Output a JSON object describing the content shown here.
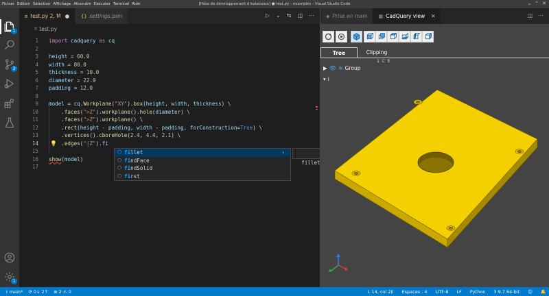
{
  "window": {
    "title": "[Hôte de développement d'extension] ● test.py - examples - Visual Studio Code",
    "menu": [
      "Fichier",
      "Edition",
      "Sélection",
      "Affichage",
      "Atteindre",
      "Exécuter",
      "Terminal",
      "Aide"
    ]
  },
  "activity": {
    "badges": {
      "explorer": "1",
      "scm": "3",
      "settings": "1"
    }
  },
  "tabs": [
    {
      "label": "test.py 2, M",
      "icon": "python-file-icon",
      "modified": true
    },
    {
      "label": "settings.json",
      "icon": "json-file-icon",
      "modified": false
    }
  ],
  "breadcrumb": {
    "file": "test.py"
  },
  "editor": {
    "lines": [
      {
        "n": "1",
        "tokens": [
          {
            "t": "import ",
            "c": "k"
          },
          {
            "t": "cadquery",
            "c": "n"
          },
          {
            "t": " as ",
            "c": "k"
          },
          {
            "t": "cq",
            "c": "n"
          }
        ]
      },
      {
        "n": "2",
        "tokens": []
      },
      {
        "n": "3",
        "tokens": [
          {
            "t": "height",
            "c": "n"
          },
          {
            "t": " = ",
            "c": ""
          },
          {
            "t": "60.0",
            "c": "num"
          }
        ]
      },
      {
        "n": "4",
        "tokens": [
          {
            "t": "width",
            "c": "n"
          },
          {
            "t": " = ",
            "c": ""
          },
          {
            "t": "80.0",
            "c": "num"
          }
        ]
      },
      {
        "n": "5",
        "tokens": [
          {
            "t": "thickness",
            "c": "n"
          },
          {
            "t": " = ",
            "c": ""
          },
          {
            "t": "10.0",
            "c": "num"
          }
        ]
      },
      {
        "n": "6",
        "tokens": [
          {
            "t": "diameter",
            "c": "n"
          },
          {
            "t": " = ",
            "c": ""
          },
          {
            "t": "22.0",
            "c": "num"
          }
        ]
      },
      {
        "n": "7",
        "tokens": [
          {
            "t": "padding",
            "c": "n"
          },
          {
            "t": " = ",
            "c": ""
          },
          {
            "t": "12.0",
            "c": "num"
          }
        ]
      },
      {
        "n": "8",
        "tokens": []
      },
      {
        "n": "9",
        "tokens": [
          {
            "t": "model",
            "c": "n"
          },
          {
            "t": " = ",
            "c": ""
          },
          {
            "t": "cq",
            "c": "n"
          },
          {
            "t": ".",
            "c": ""
          },
          {
            "t": "Workplane",
            "c": "f"
          },
          {
            "t": "(",
            "c": ""
          },
          {
            "t": "\"XY\"",
            "c": "s"
          },
          {
            "t": ").",
            "c": ""
          },
          {
            "t": "box",
            "c": "f"
          },
          {
            "t": "(",
            "c": ""
          },
          {
            "t": "height",
            "c": "n"
          },
          {
            "t": ", ",
            "c": ""
          },
          {
            "t": "width",
            "c": "n"
          },
          {
            "t": ", ",
            "c": ""
          },
          {
            "t": "thickness",
            "c": "n"
          },
          {
            "t": ") \\",
            "c": ""
          }
        ]
      },
      {
        "n": "10",
        "tokens": [
          {
            "t": "    .",
            "c": ""
          },
          {
            "t": "faces",
            "c": "f"
          },
          {
            "t": "(",
            "c": ""
          },
          {
            "t": "\">Z\"",
            "c": "s"
          },
          {
            "t": ").",
            "c": ""
          },
          {
            "t": "workplane",
            "c": "f"
          },
          {
            "t": "().",
            "c": ""
          },
          {
            "t": "hole",
            "c": "f"
          },
          {
            "t": "(",
            "c": ""
          },
          {
            "t": "diameter",
            "c": "n"
          },
          {
            "t": ") \\",
            "c": ""
          }
        ]
      },
      {
        "n": "11",
        "tokens": [
          {
            "t": "    .",
            "c": ""
          },
          {
            "t": "faces",
            "c": "f"
          },
          {
            "t": "(",
            "c": ""
          },
          {
            "t": "\">Z\"",
            "c": "s"
          },
          {
            "t": ").",
            "c": ""
          },
          {
            "t": "workplane",
            "c": "f"
          },
          {
            "t": "() \\",
            "c": ""
          }
        ]
      },
      {
        "n": "12",
        "tokens": [
          {
            "t": "    .",
            "c": ""
          },
          {
            "t": "rect",
            "c": "f"
          },
          {
            "t": "(",
            "c": ""
          },
          {
            "t": "height",
            "c": "n"
          },
          {
            "t": " - ",
            "c": ""
          },
          {
            "t": "padding",
            "c": "n"
          },
          {
            "t": ", ",
            "c": ""
          },
          {
            "t": "width",
            "c": "n"
          },
          {
            "t": " - ",
            "c": ""
          },
          {
            "t": "padding",
            "c": "n"
          },
          {
            "t": ", ",
            "c": ""
          },
          {
            "t": "forConstruction",
            "c": "n"
          },
          {
            "t": "=",
            "c": ""
          },
          {
            "t": "True",
            "c": "kw"
          },
          {
            "t": ") \\",
            "c": ""
          }
        ]
      },
      {
        "n": "13",
        "tokens": [
          {
            "t": "    .",
            "c": ""
          },
          {
            "t": "vertices",
            "c": "f"
          },
          {
            "t": "().",
            "c": ""
          },
          {
            "t": "cboreHole",
            "c": "f"
          },
          {
            "t": "(",
            "c": ""
          },
          {
            "t": "2.4",
            "c": "num"
          },
          {
            "t": ", ",
            "c": ""
          },
          {
            "t": "4.4",
            "c": "num"
          },
          {
            "t": ", ",
            "c": ""
          },
          {
            "t": "2.1",
            "c": "num"
          },
          {
            "t": ") \\",
            "c": ""
          }
        ]
      },
      {
        "n": "14",
        "tokens": [
          {
            "t": "    .",
            "c": ""
          },
          {
            "t": "edges",
            "c": "f"
          },
          {
            "t": "(",
            "c": ""
          },
          {
            "t": "\"|Z\"",
            "c": "s"
          },
          {
            "t": ").",
            "c": ""
          },
          {
            "t": "fi",
            "c": "n"
          }
        ]
      },
      {
        "n": "15",
        "tokens": []
      },
      {
        "n": "16",
        "tokens": [
          {
            "t": "show",
            "c": "f u"
          },
          {
            "t": "(",
            "c": ""
          },
          {
            "t": "model",
            "c": "n"
          },
          {
            "t": ")",
            "c": ""
          }
        ]
      },
      {
        "n": "17",
        "tokens": []
      }
    ],
    "current_line": "14"
  },
  "suggest": {
    "items": [
      {
        "match": "fi",
        "rest": "llet",
        "icon": "method-icon"
      },
      {
        "match": "fi",
        "rest": "ndFace",
        "icon": "method-icon"
      },
      {
        "match": "fi",
        "rest": "ndSolid",
        "icon": "method-icon"
      },
      {
        "match": "fi",
        "rest": "rst",
        "icon": "method-icon"
      }
    ],
    "detail": "fillet: (radius: float) -> T@fillet"
  },
  "right": {
    "tabs": [
      {
        "label": "Prise en main"
      },
      {
        "label": "CadQuery view"
      }
    ],
    "tree_tabs": [
      "Tree",
      "Clipping"
    ],
    "clip_labels": "1 C E",
    "tree": {
      "group": "Group",
      "child": "i"
    }
  },
  "status": {
    "branch": "main*",
    "sync": "0↓ 2↑",
    "problems": "⊗ 2 ⚠ 0",
    "position": "L 14, col 20",
    "spaces": "Espaces : 4",
    "encoding": "UTF-8",
    "eol": "LF",
    "language": "Python",
    "interpreter": "3.9.7 64-bit"
  },
  "colors": {
    "accent": "#007acc",
    "model": "#f5d000",
    "viewer_bg": "#444444"
  }
}
